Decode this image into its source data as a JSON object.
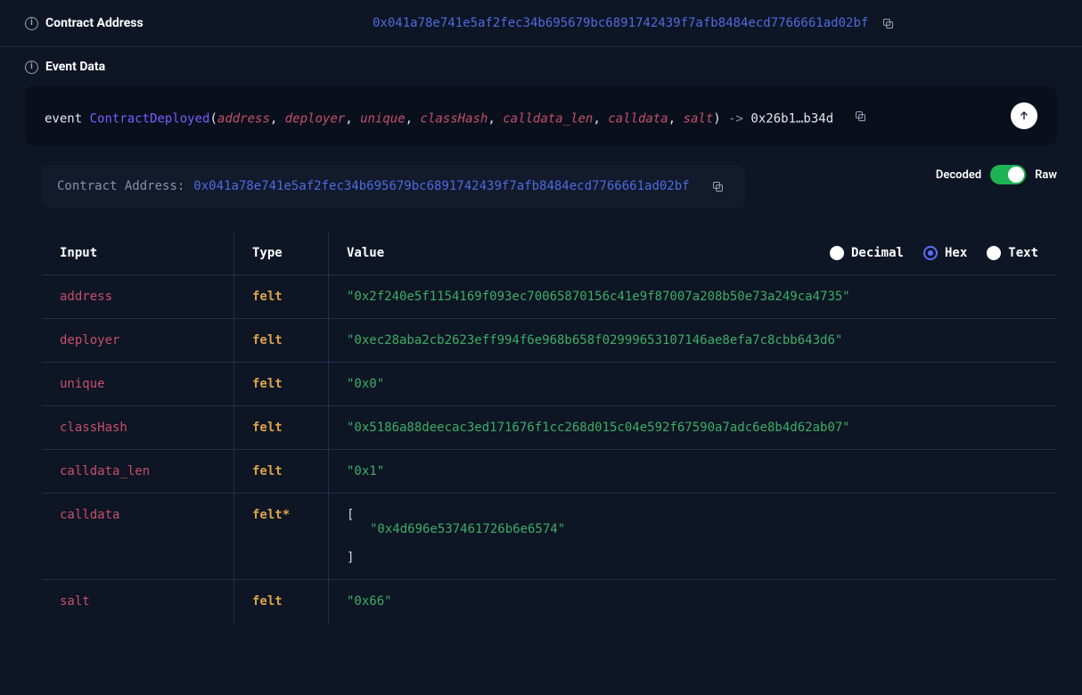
{
  "header": {
    "contract_address_label": "Contract Address",
    "contract_address_value": "0x041a78e741e5af2fec34b695679bc6891742439f7afb8484ecd7766661ad02bf",
    "event_data_label": "Event Data"
  },
  "event_sig": {
    "keyword": "event",
    "name": "ContractDeployed",
    "params": [
      "address",
      "deployer",
      "unique",
      "classHash",
      "calldata_len",
      "calldata",
      "salt"
    ],
    "arrow": "->",
    "result_hash": "0x26b1…b34d"
  },
  "sub": {
    "contract_address_label": "Contract Address:",
    "contract_address_value": "0x041a78e741e5af2fec34b695679bc6891742439f7afb8484ecd7766661ad02bf"
  },
  "toggles": {
    "decoded_label": "Decoded",
    "raw_label": "Raw"
  },
  "table": {
    "headers": {
      "input": "Input",
      "type": "Type",
      "value": "Value"
    },
    "radios": {
      "decimal": "Decimal",
      "hex": "Hex",
      "text": "Text",
      "selected": "hex"
    },
    "rows": [
      {
        "input": "address",
        "type": "felt",
        "value": "\"0x2f240e5f1154169f093ec70065870156c41e9f87007a208b50e73a249ca4735\""
      },
      {
        "input": "deployer",
        "type": "felt",
        "value": "\"0xec28aba2cb2623eff994f6e968b658f02999653107146ae8efa7c8cbb643d6\""
      },
      {
        "input": "unique",
        "type": "felt",
        "value": "\"0x0\""
      },
      {
        "input": "classHash",
        "type": "felt",
        "value": "\"0x5186a88deecac3ed171676f1cc268d015c04e592f67590a7adc6e8b4d62ab07\""
      },
      {
        "input": "calldata_len",
        "type": "felt",
        "value": "\"0x1\""
      },
      {
        "input": "calldata",
        "type": "felt*",
        "value_array": [
          "\"0x4d696e537461726b6e6574\""
        ]
      },
      {
        "input": "salt",
        "type": "felt",
        "value": "\"0x66\""
      }
    ]
  }
}
